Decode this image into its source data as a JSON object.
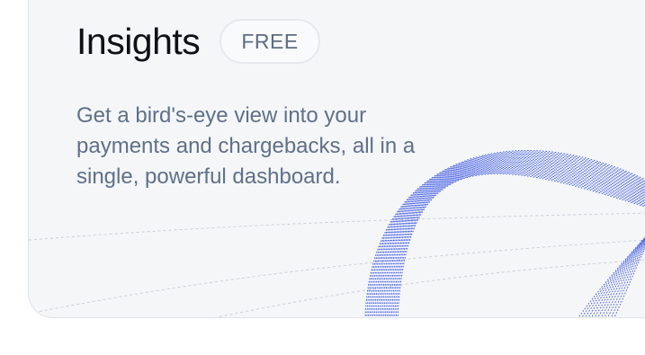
{
  "card": {
    "title": "Insights",
    "badge": "FREE",
    "description": "Get a bird's-eye view into your payments and chargebacks, all in a single, powerful dashboard.",
    "decoration_icon": "dotted-arc-swirl-icon",
    "accent_color": "#2f4de0"
  }
}
